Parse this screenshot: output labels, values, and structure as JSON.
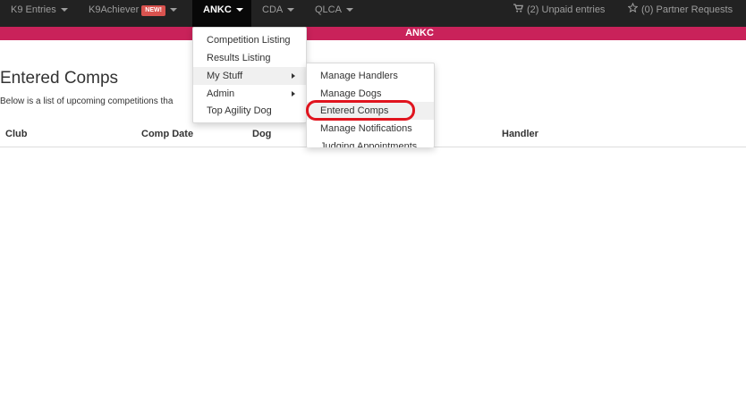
{
  "navbar": {
    "items": [
      {
        "label": "K9 Entries",
        "caret": true
      },
      {
        "label": "K9Achiever",
        "badge": "NEW!",
        "caret": true
      },
      {
        "label": "ANKC",
        "caret": true,
        "active": true
      },
      {
        "label": "CDA",
        "caret": true
      },
      {
        "label": "QLCA",
        "caret": true
      }
    ],
    "right": {
      "cart_icon": "shopping-cart-icon",
      "unpaid": "(2) Unpaid entries",
      "star_icon": "star-icon",
      "partner": "(0) Partner Requests"
    }
  },
  "band": {
    "title": "ANKC",
    "color": "#c9225a"
  },
  "page": {
    "title": "Entered Comps",
    "description": "Below is a list of upcoming competitions tha"
  },
  "table": {
    "headers": [
      "Club",
      "Comp Date",
      "Dog",
      "Handler"
    ]
  },
  "ankc_menu": {
    "items": [
      "Competition Listing",
      "Results Listing",
      "My Stuff",
      "Admin",
      "Top Agility Dog"
    ]
  },
  "mystuff_menu": {
    "items": [
      "Manage Handlers",
      "Manage Dogs",
      "Entered Comps",
      "Manage Notifications",
      "Judging Appointments"
    ]
  },
  "colors": {
    "accent": "#c9225a",
    "highlight": "#e0141e",
    "navbar": "#222222"
  }
}
